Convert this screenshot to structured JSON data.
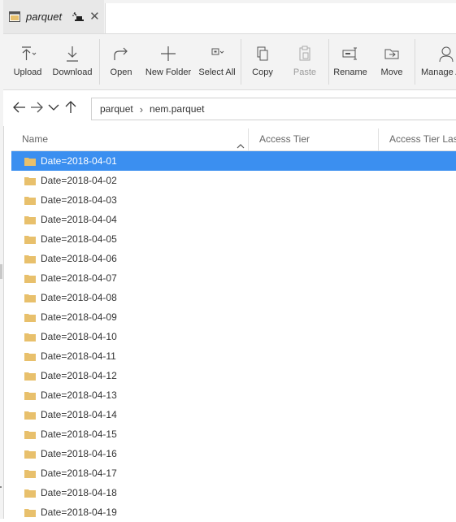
{
  "tab": {
    "title": "parquet",
    "close_glyph": "✕"
  },
  "toolbar": {
    "items": [
      {
        "label": "Upload",
        "icon": "upload-icon",
        "enabled": true
      },
      {
        "label": "Download",
        "icon": "download-icon",
        "enabled": true
      },
      {
        "label": "Open",
        "icon": "open-icon",
        "enabled": true
      },
      {
        "label": "New Folder",
        "icon": "plus-icon",
        "enabled": true
      },
      {
        "label": "Select All",
        "icon": "select-all-icon",
        "enabled": true
      },
      {
        "label": "Copy",
        "icon": "copy-icon",
        "enabled": true
      },
      {
        "label": "Paste",
        "icon": "paste-icon",
        "enabled": false
      },
      {
        "label": "Rename",
        "icon": "rename-icon",
        "enabled": true
      },
      {
        "label": "Move",
        "icon": "move-icon",
        "enabled": true
      },
      {
        "label": "Manage A",
        "icon": "user-icon",
        "enabled": true
      }
    ]
  },
  "address": {
    "crumbs": [
      "parquet",
      "nem.parquet"
    ],
    "separator": "›"
  },
  "columns": {
    "name": "Name",
    "access_tier": "Access Tier",
    "access_tier_last": "Access Tier Last"
  },
  "rows": [
    {
      "name": "Date=2018-04-01",
      "selected": true
    },
    {
      "name": "Date=2018-04-02",
      "selected": false
    },
    {
      "name": "Date=2018-04-03",
      "selected": false
    },
    {
      "name": "Date=2018-04-04",
      "selected": false
    },
    {
      "name": "Date=2018-04-05",
      "selected": false
    },
    {
      "name": "Date=2018-04-06",
      "selected": false
    },
    {
      "name": "Date=2018-04-07",
      "selected": false
    },
    {
      "name": "Date=2018-04-08",
      "selected": false
    },
    {
      "name": "Date=2018-04-09",
      "selected": false
    },
    {
      "name": "Date=2018-04-10",
      "selected": false
    },
    {
      "name": "Date=2018-04-11",
      "selected": false
    },
    {
      "name": "Date=2018-04-12",
      "selected": false
    },
    {
      "name": "Date=2018-04-13",
      "selected": false
    },
    {
      "name": "Date=2018-04-14",
      "selected": false
    },
    {
      "name": "Date=2018-04-15",
      "selected": false
    },
    {
      "name": "Date=2018-04-16",
      "selected": false
    },
    {
      "name": "Date=2018-04-17",
      "selected": false
    },
    {
      "name": "Date=2018-04-18",
      "selected": false
    },
    {
      "name": "Date=2018-04-19",
      "selected": false
    }
  ],
  "colors": {
    "selection": "#3b8ff0",
    "folder": "#e8c06c",
    "toolbar_bg": "#f3f3f3"
  }
}
